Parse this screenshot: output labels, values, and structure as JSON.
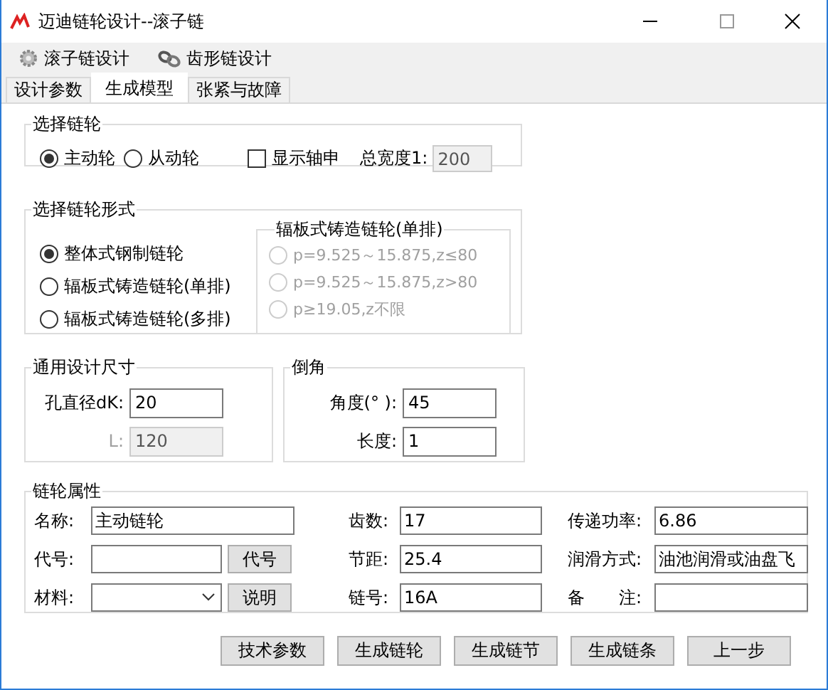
{
  "window": {
    "title": "迈迪链轮设计--滚子链"
  },
  "toolbar": [
    {
      "label": "滚子链设计",
      "kind": "gear"
    },
    {
      "label": "齿形链设计",
      "kind": "chain"
    }
  ],
  "tabs": [
    {
      "label": "设计参数",
      "selected": false
    },
    {
      "label": "生成模型",
      "selected": true
    },
    {
      "label": "张紧与故障",
      "selected": false
    }
  ],
  "sprocket_select": {
    "title": "选择链轮",
    "options": [
      {
        "label": "主动轮",
        "selected": true
      },
      {
        "label": "从动轮",
        "selected": false
      }
    ],
    "show_shaft": {
      "label": "显示轴申",
      "checked": false
    },
    "total_width": {
      "label": "总宽度1:",
      "value": "200",
      "disabled": true
    }
  },
  "sprocket_form": {
    "title": "选择链轮形式",
    "options": [
      {
        "label": "整体式钢制链轮",
        "selected": true
      },
      {
        "label": "辐板式铸造链轮(单排)",
        "selected": false
      },
      {
        "label": "辐板式铸造链轮(多排)",
        "selected": false
      }
    ],
    "spoke_group": {
      "title": "辐板式铸造链轮(单排)",
      "disabled": true,
      "options": [
        {
          "label": "p=9.525～15.875,z≤80",
          "selected": false
        },
        {
          "label": "p=9.525～15.875,z>80",
          "selected": false
        },
        {
          "label": "p≥19.05,z不限",
          "selected": false
        }
      ]
    }
  },
  "general_size": {
    "title": "通用设计尺寸",
    "fields": [
      {
        "label": "孔直径dK:",
        "value": "20",
        "disabled": false
      },
      {
        "label": "L:",
        "value": "120",
        "disabled": true
      }
    ]
  },
  "chamfer": {
    "title": "倒角",
    "fields": [
      {
        "label": "角度(° ):",
        "value": "45",
        "disabled": false
      },
      {
        "label": "长度:",
        "value": "1",
        "disabled": false
      }
    ]
  },
  "properties": {
    "title": "链轮属性",
    "fields": [
      {
        "label": "名称:",
        "value": "主动链轮",
        "kind": "text"
      },
      {
        "label": "齿数:",
        "value": "17",
        "kind": "text"
      },
      {
        "label": "传递功率:",
        "value": "6.86",
        "kind": "text"
      },
      {
        "label": "代号:",
        "kind": "text_button",
        "button": "代号"
      },
      {
        "label": "节距:",
        "value": "25.4",
        "kind": "text"
      },
      {
        "label": "润滑方式:",
        "value": "油池润滑或油盘飞",
        "kind": "text"
      },
      {
        "label": "材料:",
        "kind": "combo_button",
        "button": "说明"
      },
      {
        "label": "链号:",
        "value": "16A",
        "kind": "text"
      },
      {
        "label": "备　　注:",
        "kind": "text"
      }
    ]
  },
  "buttons": [
    "技术参数",
    "生成链轮",
    "生成链节",
    "生成链条",
    "上一步"
  ]
}
